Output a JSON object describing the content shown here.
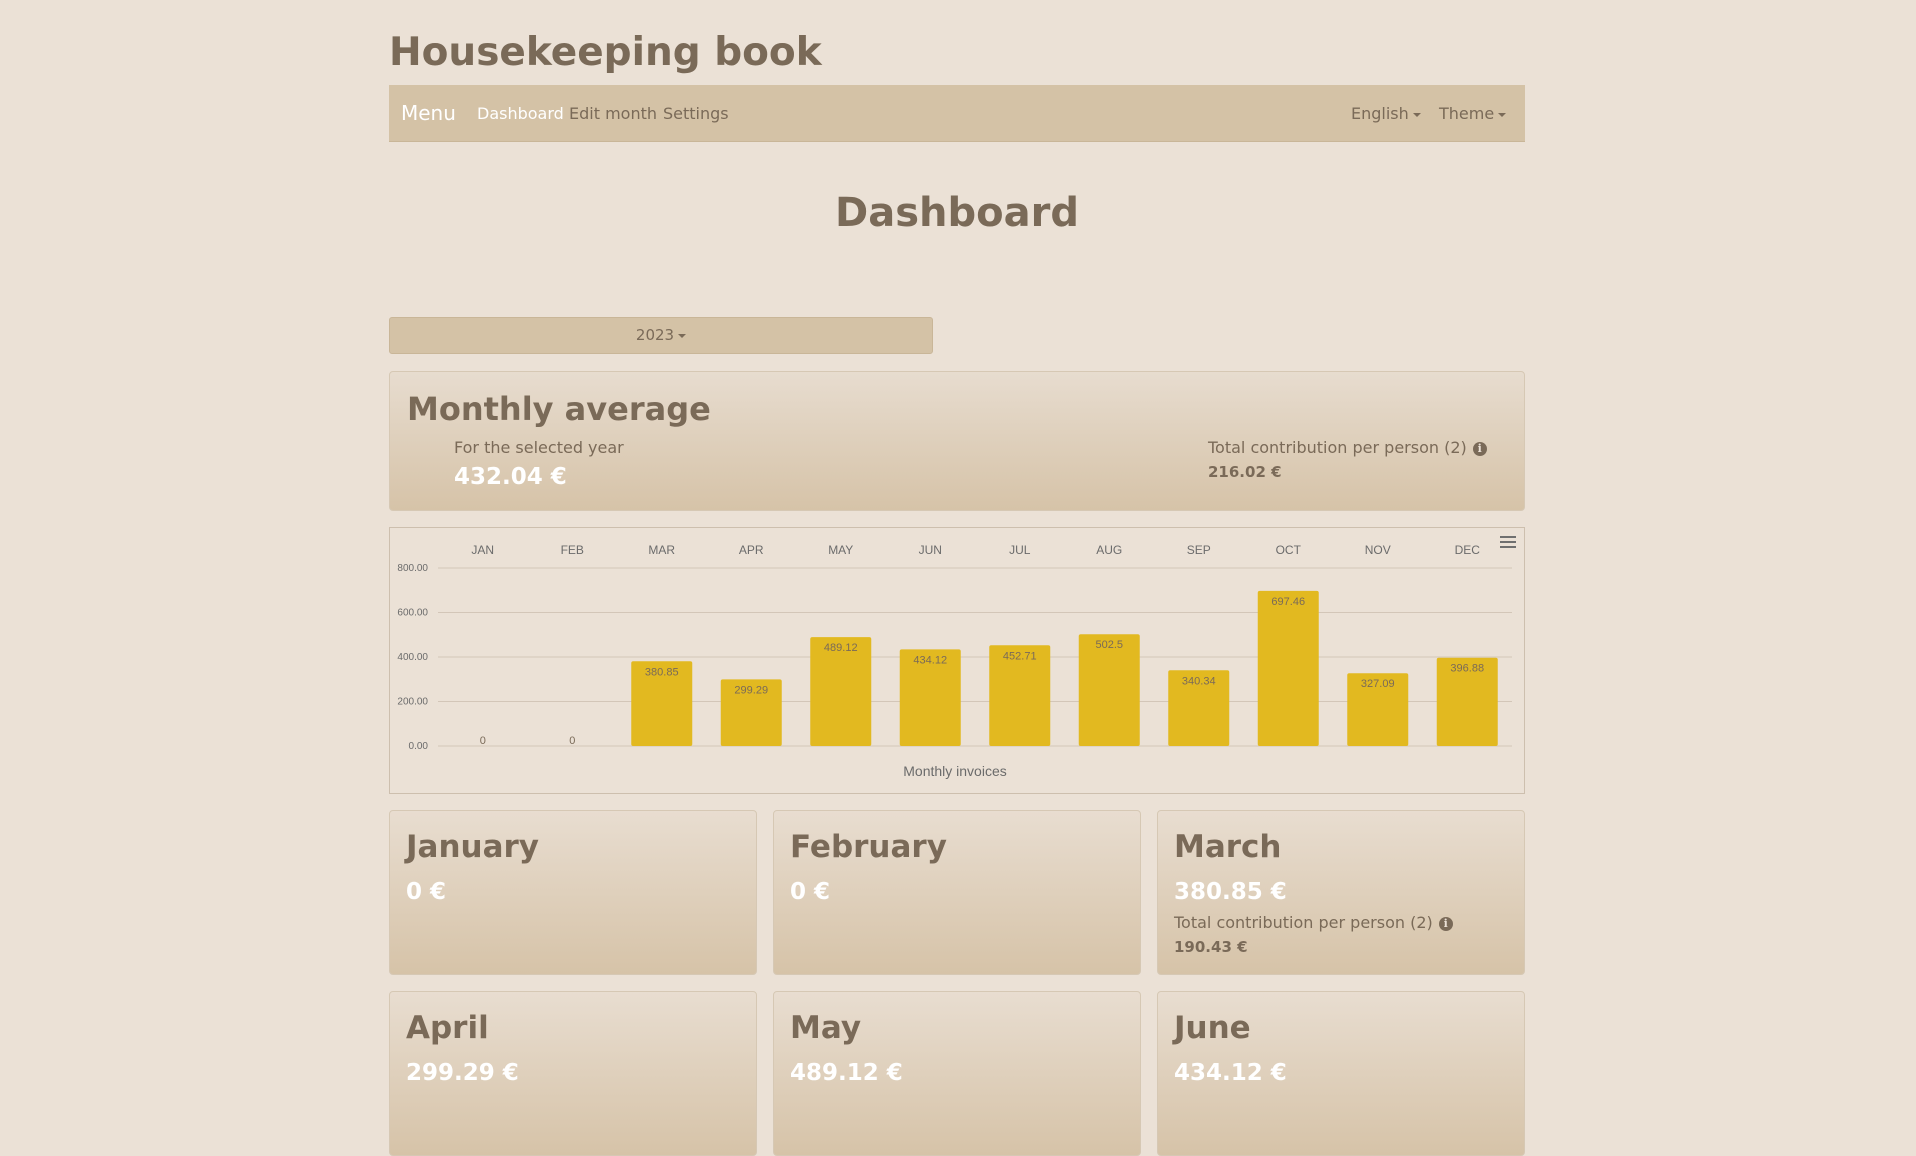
{
  "app": {
    "title": "Housekeeping book"
  },
  "nav": {
    "brand": "Menu",
    "links": [
      "Dashboard",
      "Edit month",
      "Settings"
    ],
    "active": "Dashboard",
    "language": "English",
    "theme": "Theme"
  },
  "page": {
    "title": "Dashboard"
  },
  "year_select": {
    "value": "2023"
  },
  "average": {
    "title": "Monthly average",
    "subtitle": "For the selected year",
    "value": "432.04 €",
    "contrib_label": "Total contribution per person (2)",
    "contrib_value": "216.02 €"
  },
  "colors": {
    "bar": "#e2b920",
    "background": "#ebe1d6",
    "accent": "#d4c2a6",
    "text": "#7a6a58"
  },
  "chart_data": {
    "type": "bar",
    "categories": [
      "JAN",
      "FEB",
      "MAR",
      "APR",
      "MAY",
      "JUN",
      "JUL",
      "AUG",
      "SEP",
      "OCT",
      "NOV",
      "DEC"
    ],
    "values": [
      0,
      0,
      380.85,
      299.29,
      489.12,
      434.12,
      452.71,
      502.5,
      340.34,
      697.46,
      327.09,
      396.88
    ],
    "data_labels": [
      "0",
      "0",
      "380.85",
      "299.29",
      "489.12",
      "434.12",
      "452.71",
      "502.5",
      "340.34",
      "697.46",
      "327.09",
      "396.88"
    ],
    "yticks": [
      "0.00",
      "200.00",
      "400.00",
      "600.00",
      "800.00"
    ],
    "ylim": [
      0,
      800
    ],
    "xlabel": "Monthly invoices",
    "x_axis_position": "top",
    "grid": true
  },
  "months": [
    {
      "name": "January",
      "value": "0 €"
    },
    {
      "name": "February",
      "value": "0 €"
    },
    {
      "name": "March",
      "value": "380.85 €",
      "contrib_label": "Total contribution per person (2)",
      "contrib_value": "190.43 €"
    },
    {
      "name": "April",
      "value": "299.29 €"
    },
    {
      "name": "May",
      "value": "489.12 €"
    },
    {
      "name": "June",
      "value": "434.12 €"
    }
  ]
}
